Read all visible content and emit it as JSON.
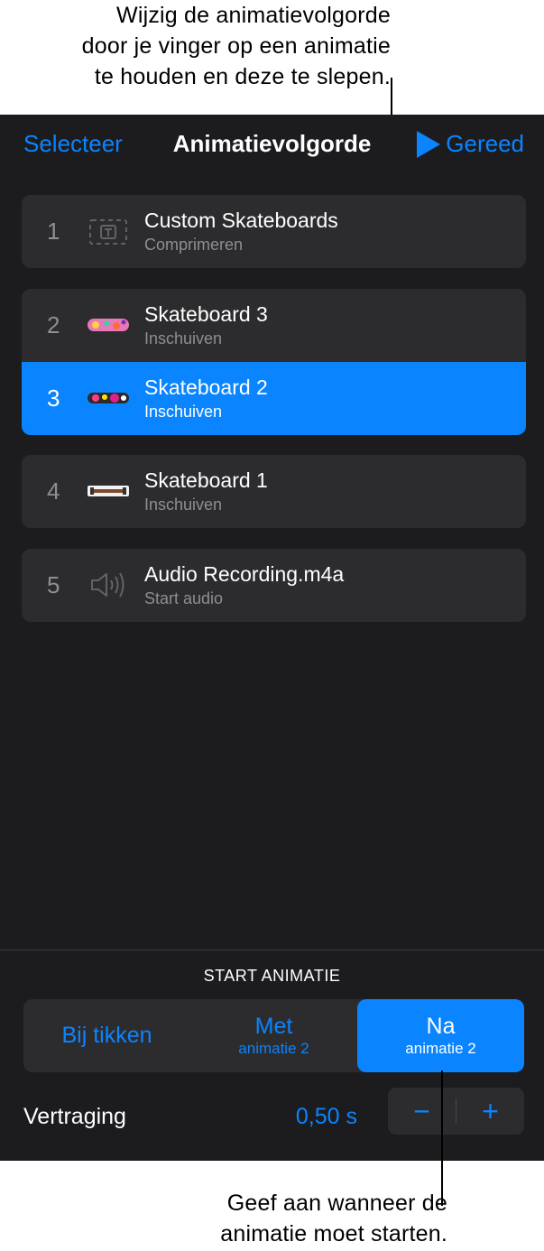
{
  "callouts": {
    "top": "Wijzig de animatievolgorde\ndoor je vinger op een animatie\nte houden en deze te slepen.",
    "bottom": "Geef aan wanneer de\nanimatie moet starten."
  },
  "nav": {
    "left_label": "Selecteer",
    "title": "Animatievolgorde",
    "right_label": "Gereed"
  },
  "animations": [
    {
      "number": "1",
      "title": "Custom Skateboards",
      "subtitle": "Comprimeren",
      "icon": "text-box-icon"
    },
    {
      "number": "2",
      "title": "Skateboard 3",
      "subtitle": "Inschuiven",
      "icon": "skateboard-3-thumbnail"
    },
    {
      "number": "3",
      "title": "Skateboard 2",
      "subtitle": "Inschuiven",
      "icon": "skateboard-2-thumbnail",
      "selected": true
    },
    {
      "number": "4",
      "title": "Skateboard 1",
      "subtitle": "Inschuiven",
      "icon": "skateboard-1-thumbnail"
    },
    {
      "number": "5",
      "title": "Audio Recording.m4a",
      "subtitle": "Start audio",
      "icon": "speaker-icon"
    }
  ],
  "start": {
    "label": "START ANIMATIE",
    "options": [
      {
        "main": "Bij tikken",
        "sub": ""
      },
      {
        "main": "Met",
        "sub": "animatie 2"
      },
      {
        "main": "Na",
        "sub": "animatie 2",
        "selected": true
      }
    ],
    "delay_label": "Vertraging",
    "delay_value": "0,50 s",
    "minus": "−",
    "plus": "+"
  },
  "colors": {
    "accent": "#0a84ff",
    "panel": "#1c1c1e",
    "row": "#2c2c2e"
  }
}
